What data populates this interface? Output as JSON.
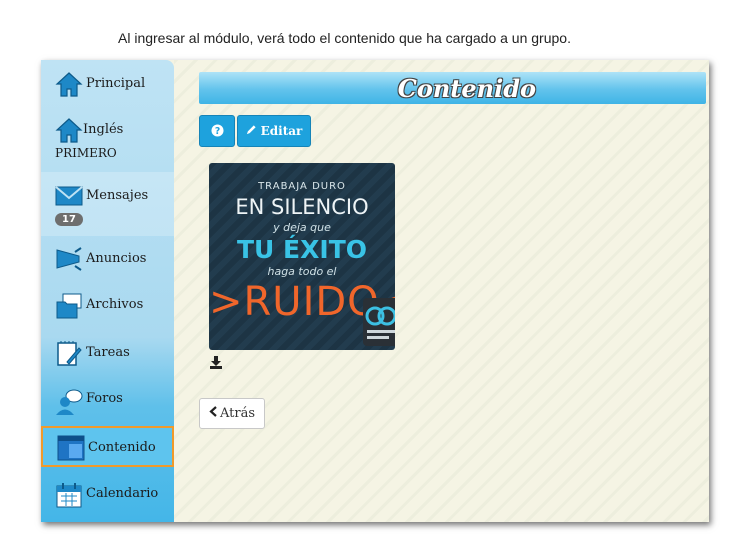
{
  "caption": "Al ingresar al módulo, verá todo el contenido que ha cargado a un grupo.",
  "sidebar": {
    "items": [
      {
        "label": "Principal"
      },
      {
        "label": "Inglés",
        "sublabel": "PRIMERO"
      },
      {
        "label": "Mensajes",
        "badge": "17"
      },
      {
        "label": "Anuncios"
      },
      {
        "label": "Archivos"
      },
      {
        "label": "Tareas"
      },
      {
        "label": "Foros"
      },
      {
        "label": "Contenido"
      },
      {
        "label": "Calendario"
      }
    ]
  },
  "main": {
    "title": "Contenido",
    "edit_label": "Editar",
    "back_label": "Atrás",
    "poster": {
      "line1": "TRABAJA DURO",
      "line2": "EN SILENCIO",
      "line3": "y deja que",
      "line4": "TU ÉXITO",
      "line5": "haga todo el",
      "line6": ">RUIDO<"
    }
  },
  "colors": {
    "accent": "#1ea2dd",
    "active_border": "#f19a2a",
    "sidebar_top": "#bfe3f4",
    "sidebar_bottom": "#44b6e8"
  }
}
